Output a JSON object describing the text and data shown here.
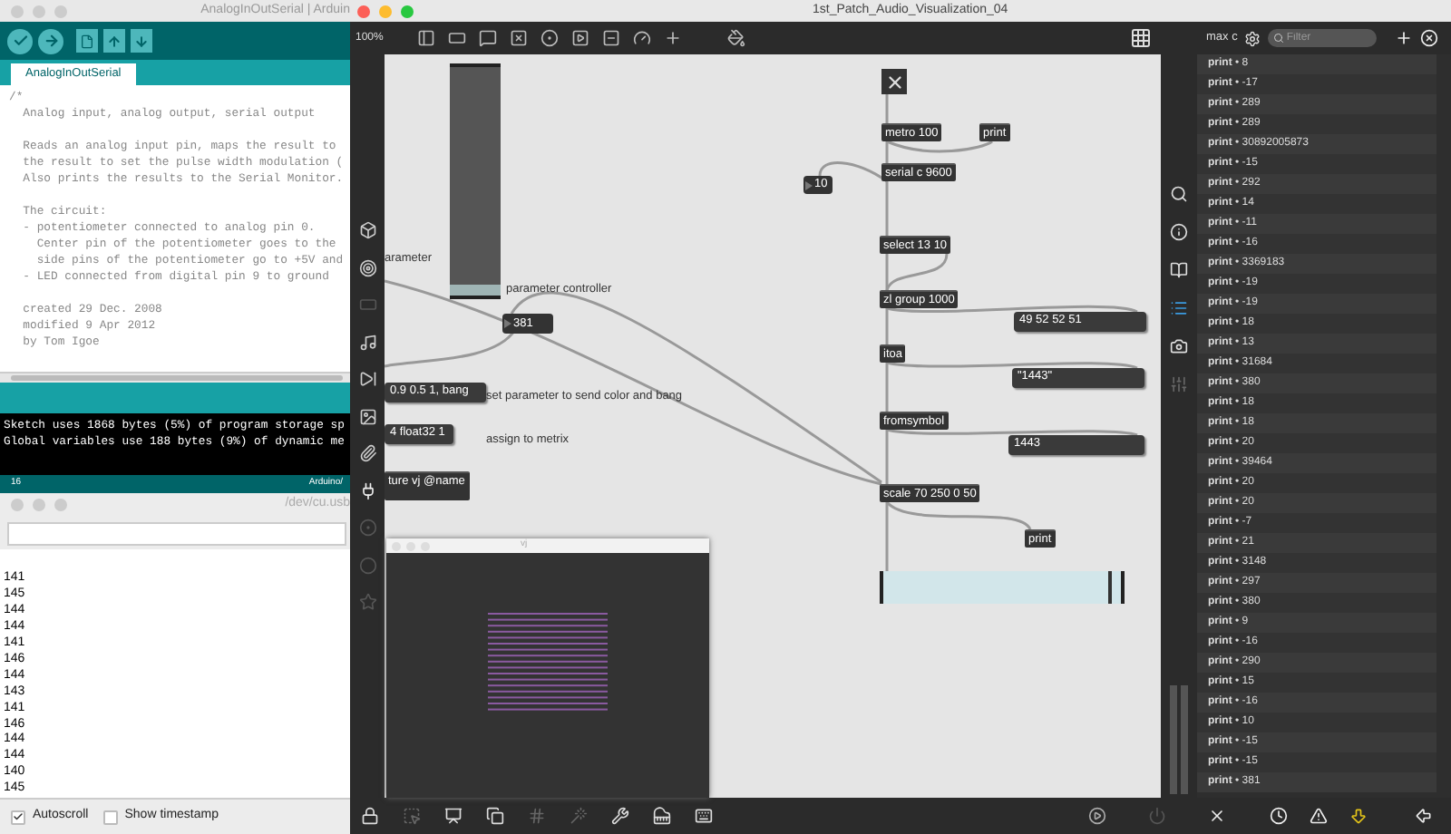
{
  "arduino": {
    "title": "AnalogInOutSerial | Arduin",
    "tabs": [
      {
        "label": "AnalogInOutSerial",
        "selected": true
      }
    ],
    "code_blocks": [
      [
        "/*",
        "  Analog input, analog output, serial output"
      ],
      [
        "  Reads an analog input pin, maps the result to",
        "  the result to set the pulse width modulation (",
        "  Also prints the results to the Serial Monitor."
      ],
      [
        "  The circuit:",
        "  - potentiometer connected to analog pin 0.",
        "    Center pin of the potentiometer goes to the",
        "    side pins of the potentiometer go to +5V and",
        "  - LED connected from digital pin 9 to ground"
      ],
      [
        "  created 29 Dec. 2008",
        "  modified 9 Apr 2012",
        "  by Tom Igoe"
      ]
    ],
    "console_lines": [
      "Sketch uses 1868 bytes (5%) of program storage sp",
      "Global variables use 188 bytes (9%) of dynamic me"
    ],
    "status": {
      "line": "16",
      "board": "Arduino/"
    }
  },
  "serial_monitor": {
    "title": "/dev/cu.usb",
    "lines": [
      "141",
      "145",
      "144",
      "144",
      "141",
      "146",
      "144",
      "143",
      "141",
      "146",
      "144",
      "144",
      "140",
      "145"
    ],
    "options": [
      {
        "label": "Autoscroll",
        "checked": true
      },
      {
        "label": "Show timestamp",
        "checked": false
      }
    ]
  },
  "max": {
    "title": "1st_Patch_Audio_Visualization_04",
    "zoom": "100%",
    "patch": [
      {
        "kind": "toggle",
        "checked": true
      },
      {
        "kind": "object",
        "text": "metro 100"
      },
      {
        "kind": "object",
        "text": "print"
      },
      {
        "kind": "number",
        "text": "10"
      },
      {
        "kind": "object",
        "text": "serial c 9600"
      },
      {
        "kind": "comment",
        "text": "arameter"
      },
      {
        "kind": "vslider",
        "level": 0.05
      },
      {
        "kind": "object",
        "text": "select 13 10"
      },
      {
        "kind": "comment",
        "text": "parameter controller"
      },
      {
        "kind": "object",
        "text": "zl group 1000"
      },
      {
        "kind": "number",
        "text": "381"
      },
      {
        "kind": "message",
        "text": "49 52 52 51"
      },
      {
        "kind": "object",
        "text": "itoa"
      },
      {
        "kind": "message",
        "text": "0.9 0.5 1, bang"
      },
      {
        "kind": "comment",
        "text": "set parameter to send color and bang"
      },
      {
        "kind": "message",
        "text": "\"1443\""
      },
      {
        "kind": "object",
        "text": "fromsymbol"
      },
      {
        "kind": "message",
        "text": "4 float32 1"
      },
      {
        "kind": "comment",
        "text": "assign to metrix"
      },
      {
        "kind": "message",
        "text": "1443"
      },
      {
        "kind": "object",
        "text": "ture vj @name"
      },
      {
        "kind": "object",
        "text": "scale 70 250 0 50"
      },
      {
        "kind": "object",
        "text": "print"
      },
      {
        "kind": "hslider",
        "level": 0.95
      }
    ],
    "vj_window": {
      "title": "vj"
    },
    "console": {
      "label": "max c",
      "filter_placeholder": "Filter",
      "rows": [
        "**print** • 8",
        "**print** • -17",
        "**print** • 289",
        "**print** • 289",
        "**print** • 30892005873",
        "**print** • -15",
        "**print** • 292",
        "**print** • 14",
        "**print** • -11",
        "**print** • -16",
        "**print** • 3369183",
        "**print** • -19",
        "**print** • -19",
        "**print** • 18",
        "**print** • 13",
        "**print** • 31684",
        "**print** • 380",
        "**print** • 18",
        "**print** • 18",
        "**print** • 20",
        "**print** • 39464",
        "**print** • 20",
        "**print** • 20",
        "**print** • -7",
        "**print** • 21",
        "**print** • 3148",
        "**print** • 297",
        "**print** • 380",
        "**print** • 9",
        "**print** • -16",
        "**print** • 290",
        "**print** • 15",
        "**print** • -16",
        "**print** • 10",
        "**print** • -15",
        "**print** • -15",
        "**print** • 381"
      ]
    }
  }
}
